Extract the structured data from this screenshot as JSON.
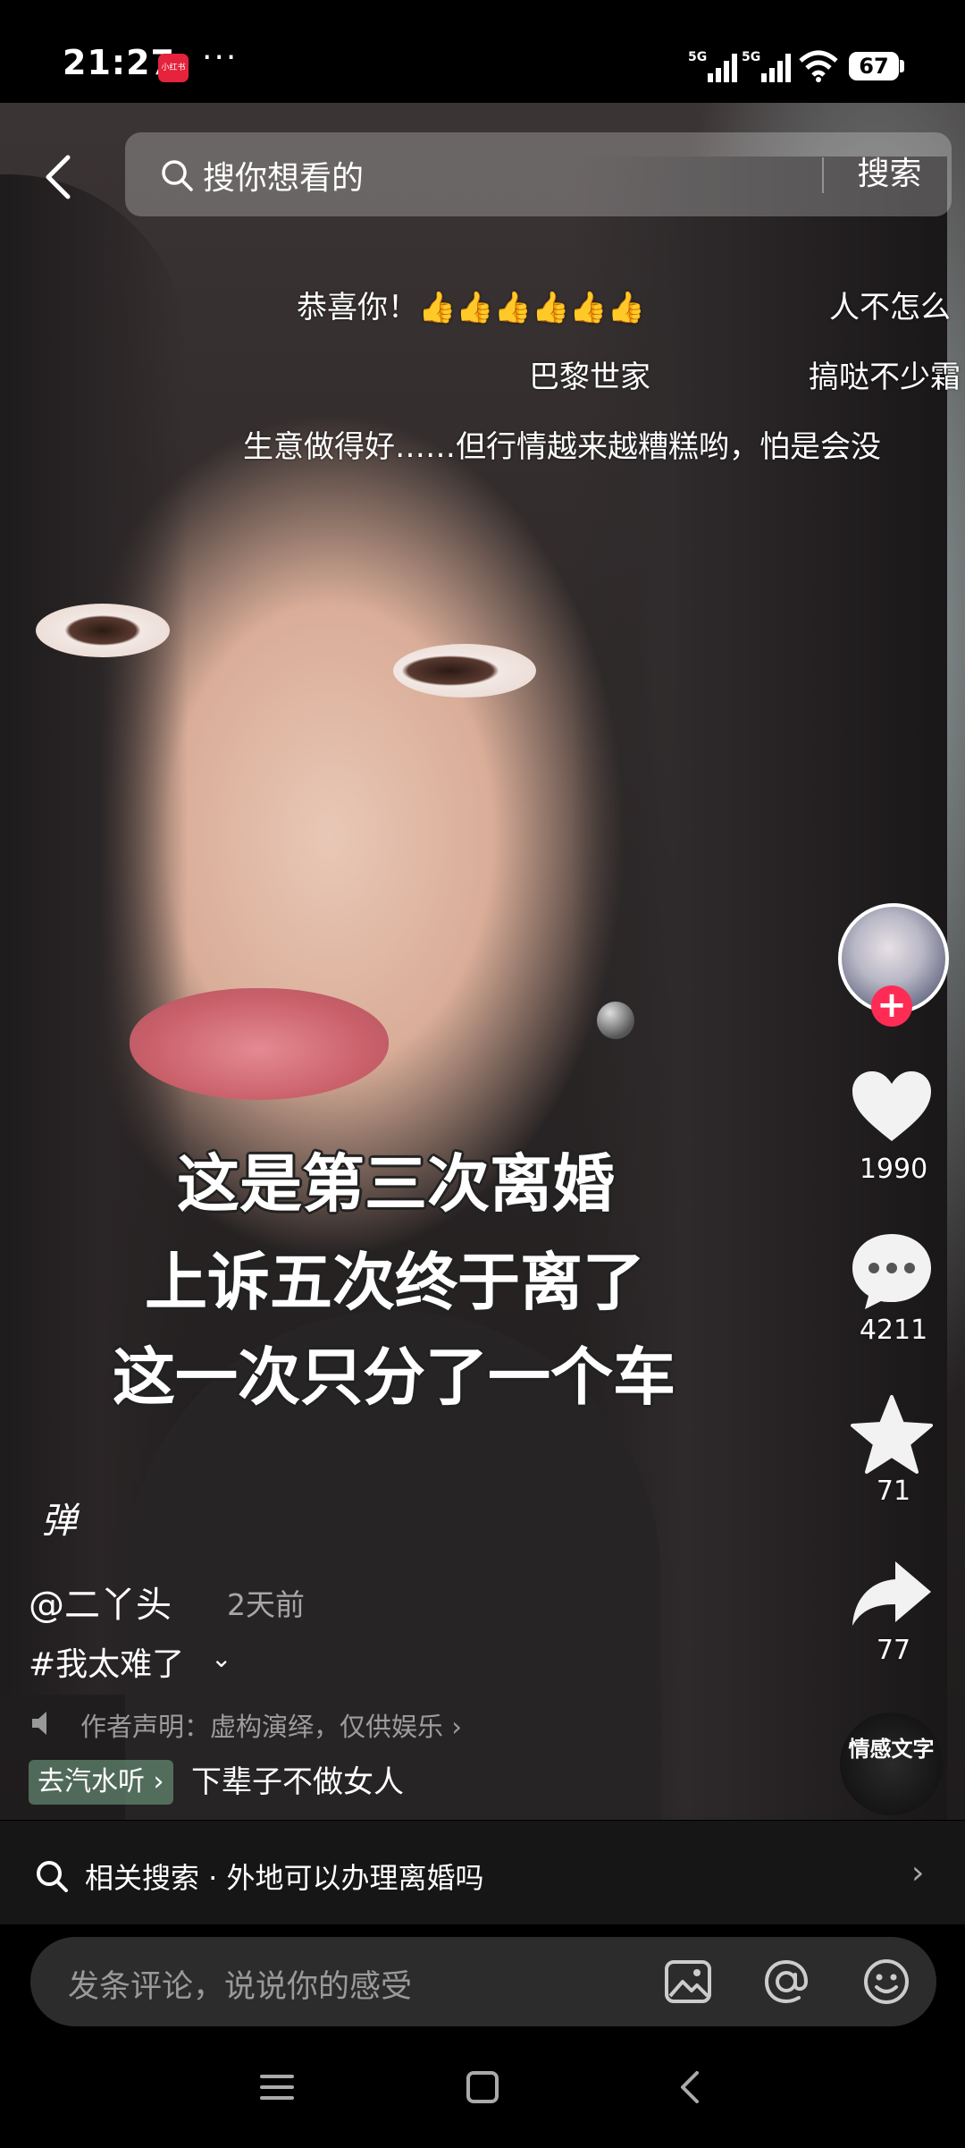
{
  "status_bar": {
    "time": "21:27",
    "app_badge": "小红书",
    "more": "···",
    "signal1_label": "5G",
    "signal2_label": "5G",
    "battery": "67"
  },
  "search": {
    "placeholder": "搜你想看的",
    "button": "搜索"
  },
  "danmaku": [
    "恭喜你！👍👍👍👍👍👍",
    "人不怎么",
    "巴黎世家",
    "搞哒不少霜",
    "生意做得好……但行情越来越糟糕哟，怕是会没"
  ],
  "caption_lines": [
    "这是第三次离婚",
    "上诉五次终于离了",
    "这一次只分了一个车"
  ],
  "actions": {
    "likes": "1990",
    "comments": "4211",
    "favorites": "71",
    "shares": "77"
  },
  "music_disc": "情感文字",
  "info": {
    "danmu_toggle": "弹",
    "author": "@二丫头",
    "post_time": "2天前",
    "hashtag": "#我太难了",
    "hashtag_expand": "⌄",
    "disclaimer": "作者声明：虚构演绎，仅供娱乐 ›",
    "listen_tag": "去汽水听 ›",
    "music_title": "下辈子不做女人"
  },
  "related": {
    "text": "相关搜索 · 外地可以办理离婚吗",
    "arrow": "›"
  },
  "comment": {
    "placeholder": "发条评论，说说你的感受"
  },
  "colors": {
    "accent": "#fe2c55",
    "related_bg": "#161616",
    "comment_box_bg": "#2c2c2c"
  }
}
